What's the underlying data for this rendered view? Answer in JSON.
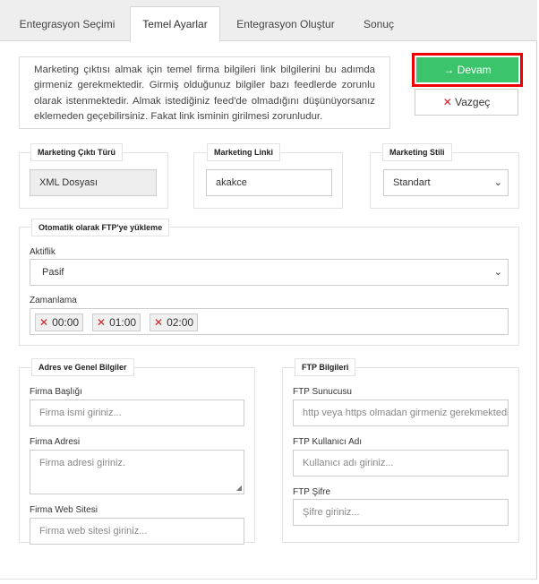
{
  "tabs": [
    "Entegrasyon Seçimi",
    "Temel Ayarlar",
    "Entegrasyon Oluştur",
    "Sonuç"
  ],
  "active_tab": "Temel Ayarlar",
  "info_text": "Marketing çıktısı almak için temel firma bilgileri link bilgilerini bu adımda girmeniz gerekmektedir. Girmiş olduğunuz bilgiler bazı feedlerde zorunlu olarak istenmektedir. Almak istediğiniz feed'de olmadığını düşünüyorsanız eklemeden geçebilirsiniz. Fakat link isminin girilmesi zorunludur.",
  "buttons": {
    "devam": "Devam",
    "vazgec": "Vazgeç"
  },
  "marketing_cikti": {
    "legend": "Marketing Çıktı Türü",
    "value": "XML Dosyası"
  },
  "marketing_linki": {
    "legend": "Marketing Linki",
    "value": "akakce"
  },
  "marketing_stili": {
    "legend": "Marketing Stili",
    "value": "Standart"
  },
  "ftp_upload": {
    "legend": "Otomatik olarak FTP'ye yükleme",
    "aktiflik_label": "Aktiflik",
    "aktiflik_value": "Pasif",
    "zamanlama_label": "Zamanlama",
    "times": [
      "00:00",
      "01:00",
      "02:00"
    ]
  },
  "adres": {
    "legend": "Adres ve Genel Bilgiler",
    "firma_basligi_label": "Firma Başlığı",
    "firma_basligi_placeholder": "Firma ismi giriniz...",
    "firma_adresi_label": "Firma Adresi",
    "firma_adresi_placeholder": "Firma adresi giriniz.",
    "web_label": "Firma Web Sitesi",
    "web_placeholder": "Firma web sitesi giriniz..."
  },
  "ftp": {
    "legend": "FTP Bilgileri",
    "sunucu_label": "FTP Sunucusu",
    "sunucu_placeholder": "http veya https olmadan girmeniz gerekmektedir",
    "kullanici_label": "FTP Kullanıcı Adı",
    "kullanici_placeholder": "Kullanıcı adı giriniz...",
    "sifre_label": "FTP Şifre",
    "sifre_placeholder": "Şifre giriniz..."
  },
  "icons": {
    "arrow": "arrow-right-icon",
    "close": "close-icon",
    "chevron": "chevron-down-icon"
  },
  "colors": {
    "devam_bg": "#3bc46b",
    "highlight_border": "#e00000",
    "remove_x": "#d62020"
  }
}
